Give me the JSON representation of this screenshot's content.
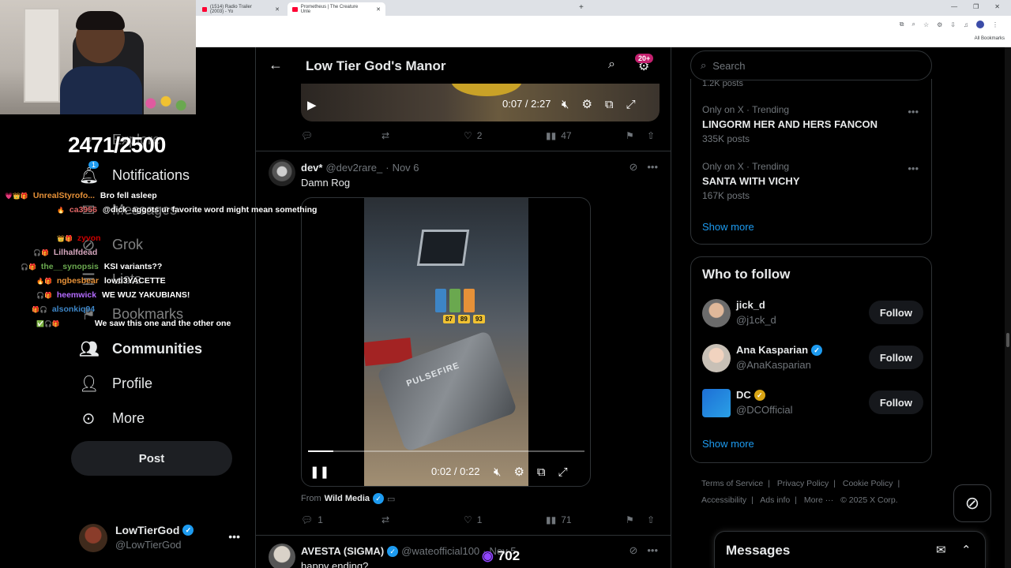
{
  "browser": {
    "tabs": [
      {
        "title": "(1514) Radio Trailer (2003) - Yo"
      },
      {
        "title": "Prometheus | The Creature Unle"
      }
    ],
    "all_bookmarks": "All Bookmarks"
  },
  "stream": {
    "counter": "2471/2500",
    "viewers": "702",
    "chat": [
      {
        "user": "UnrealStyrofo...",
        "msg": "Bro fell asleep",
        "color": "#e69138"
      },
      {
        "user": "ca3956",
        "msg": "@dick_aggots ur favorite word might mean something",
        "color": "#e06666"
      },
      {
        "user": "zyvon",
        "msg": "",
        "color": "#cc0000"
      },
      {
        "user": "Lilhalfdead",
        "msg": "",
        "color": "#d5a6bd"
      },
      {
        "user": "the__synopsis",
        "msg": "KSI variants??",
        "color": "#6aa84f"
      },
      {
        "user": "ngbesbear",
        "msg": "lowti3YACETTE",
        "color": "#e69138"
      },
      {
        "user": "heemwick",
        "msg": "WE WUZ YAKUBIANS!",
        "color": "#9900ff"
      },
      {
        "user": "alsonkiq94",
        "msg": "",
        "color": "#3d85c6"
      },
      {
        "user": "",
        "msg": "We saw this one and the other one",
        "color": "#ffffff"
      }
    ]
  },
  "nav": {
    "explore": "Explore",
    "notifications": "Notifications",
    "notif_count": "1",
    "messages": "Messages",
    "grok": "Grok",
    "lists": "Lists",
    "bookmarks": "Bookmarks",
    "communities": "Communities",
    "profile": "Profile",
    "more": "More",
    "post": "Post",
    "account": {
      "name": "LowTierGod",
      "handle": "@LowTierGod"
    }
  },
  "main": {
    "title": "Low Tier God's Manor",
    "badge": "20+",
    "top_video": {
      "time": "0:07 / 2:27"
    },
    "top_actions": {
      "likes": "2",
      "views": "47"
    },
    "tweet": {
      "name": "dev*",
      "handle": "@dev2rare_",
      "date": "Nov 6",
      "text": "Damn Rog",
      "video_time": "0:02 / 0:22",
      "progress": 0.09,
      "nozzle_text": "PULSEFIRE",
      "grades": [
        "87",
        "89",
        "93"
      ],
      "from_label": "From",
      "from_source": "Wild Media",
      "replies": "1",
      "likes": "1",
      "views": "71"
    },
    "next_tweet": {
      "name": "AVESTA (SIGMA)",
      "handle": "@wateofficial100",
      "date": "Nov 5",
      "text": "happy ending?"
    }
  },
  "right": {
    "search_placeholder": "Search",
    "trends_partial": "1.2K posts",
    "trends": [
      {
        "context": "Only on X · Trending",
        "name": "LINGORM HER AND HERS FANCON",
        "count": "335K posts"
      },
      {
        "context": "Only on X · Trending",
        "name": "SANTA WITH VICHY",
        "count": "167K posts"
      }
    ],
    "show_more": "Show more",
    "who_to_follow": {
      "title": "Who to follow",
      "users": [
        {
          "name": "jick_d",
          "handle": "@j1ck_d",
          "verified": "",
          "follow": "Follow"
        },
        {
          "name": "Ana Kasparian",
          "handle": "@AnaKasparian",
          "verified": "blue",
          "follow": "Follow"
        },
        {
          "name": "DC",
          "handle": "@DCOfficial",
          "verified": "gold",
          "follow": "Follow"
        }
      ],
      "show_more": "Show more"
    },
    "footer": {
      "terms": "Terms of Service",
      "privacy": "Privacy Policy",
      "cookie": "Cookie Policy",
      "accessibility": "Accessibility",
      "ads": "Ads info",
      "more": "More ···",
      "copyright": "© 2025 X Corp."
    },
    "messages_drawer": "Messages"
  },
  "colors": {
    "accent": "#1d9bf0",
    "border": "#2f3336",
    "muted": "#71767b",
    "badge": "#c4216f"
  }
}
